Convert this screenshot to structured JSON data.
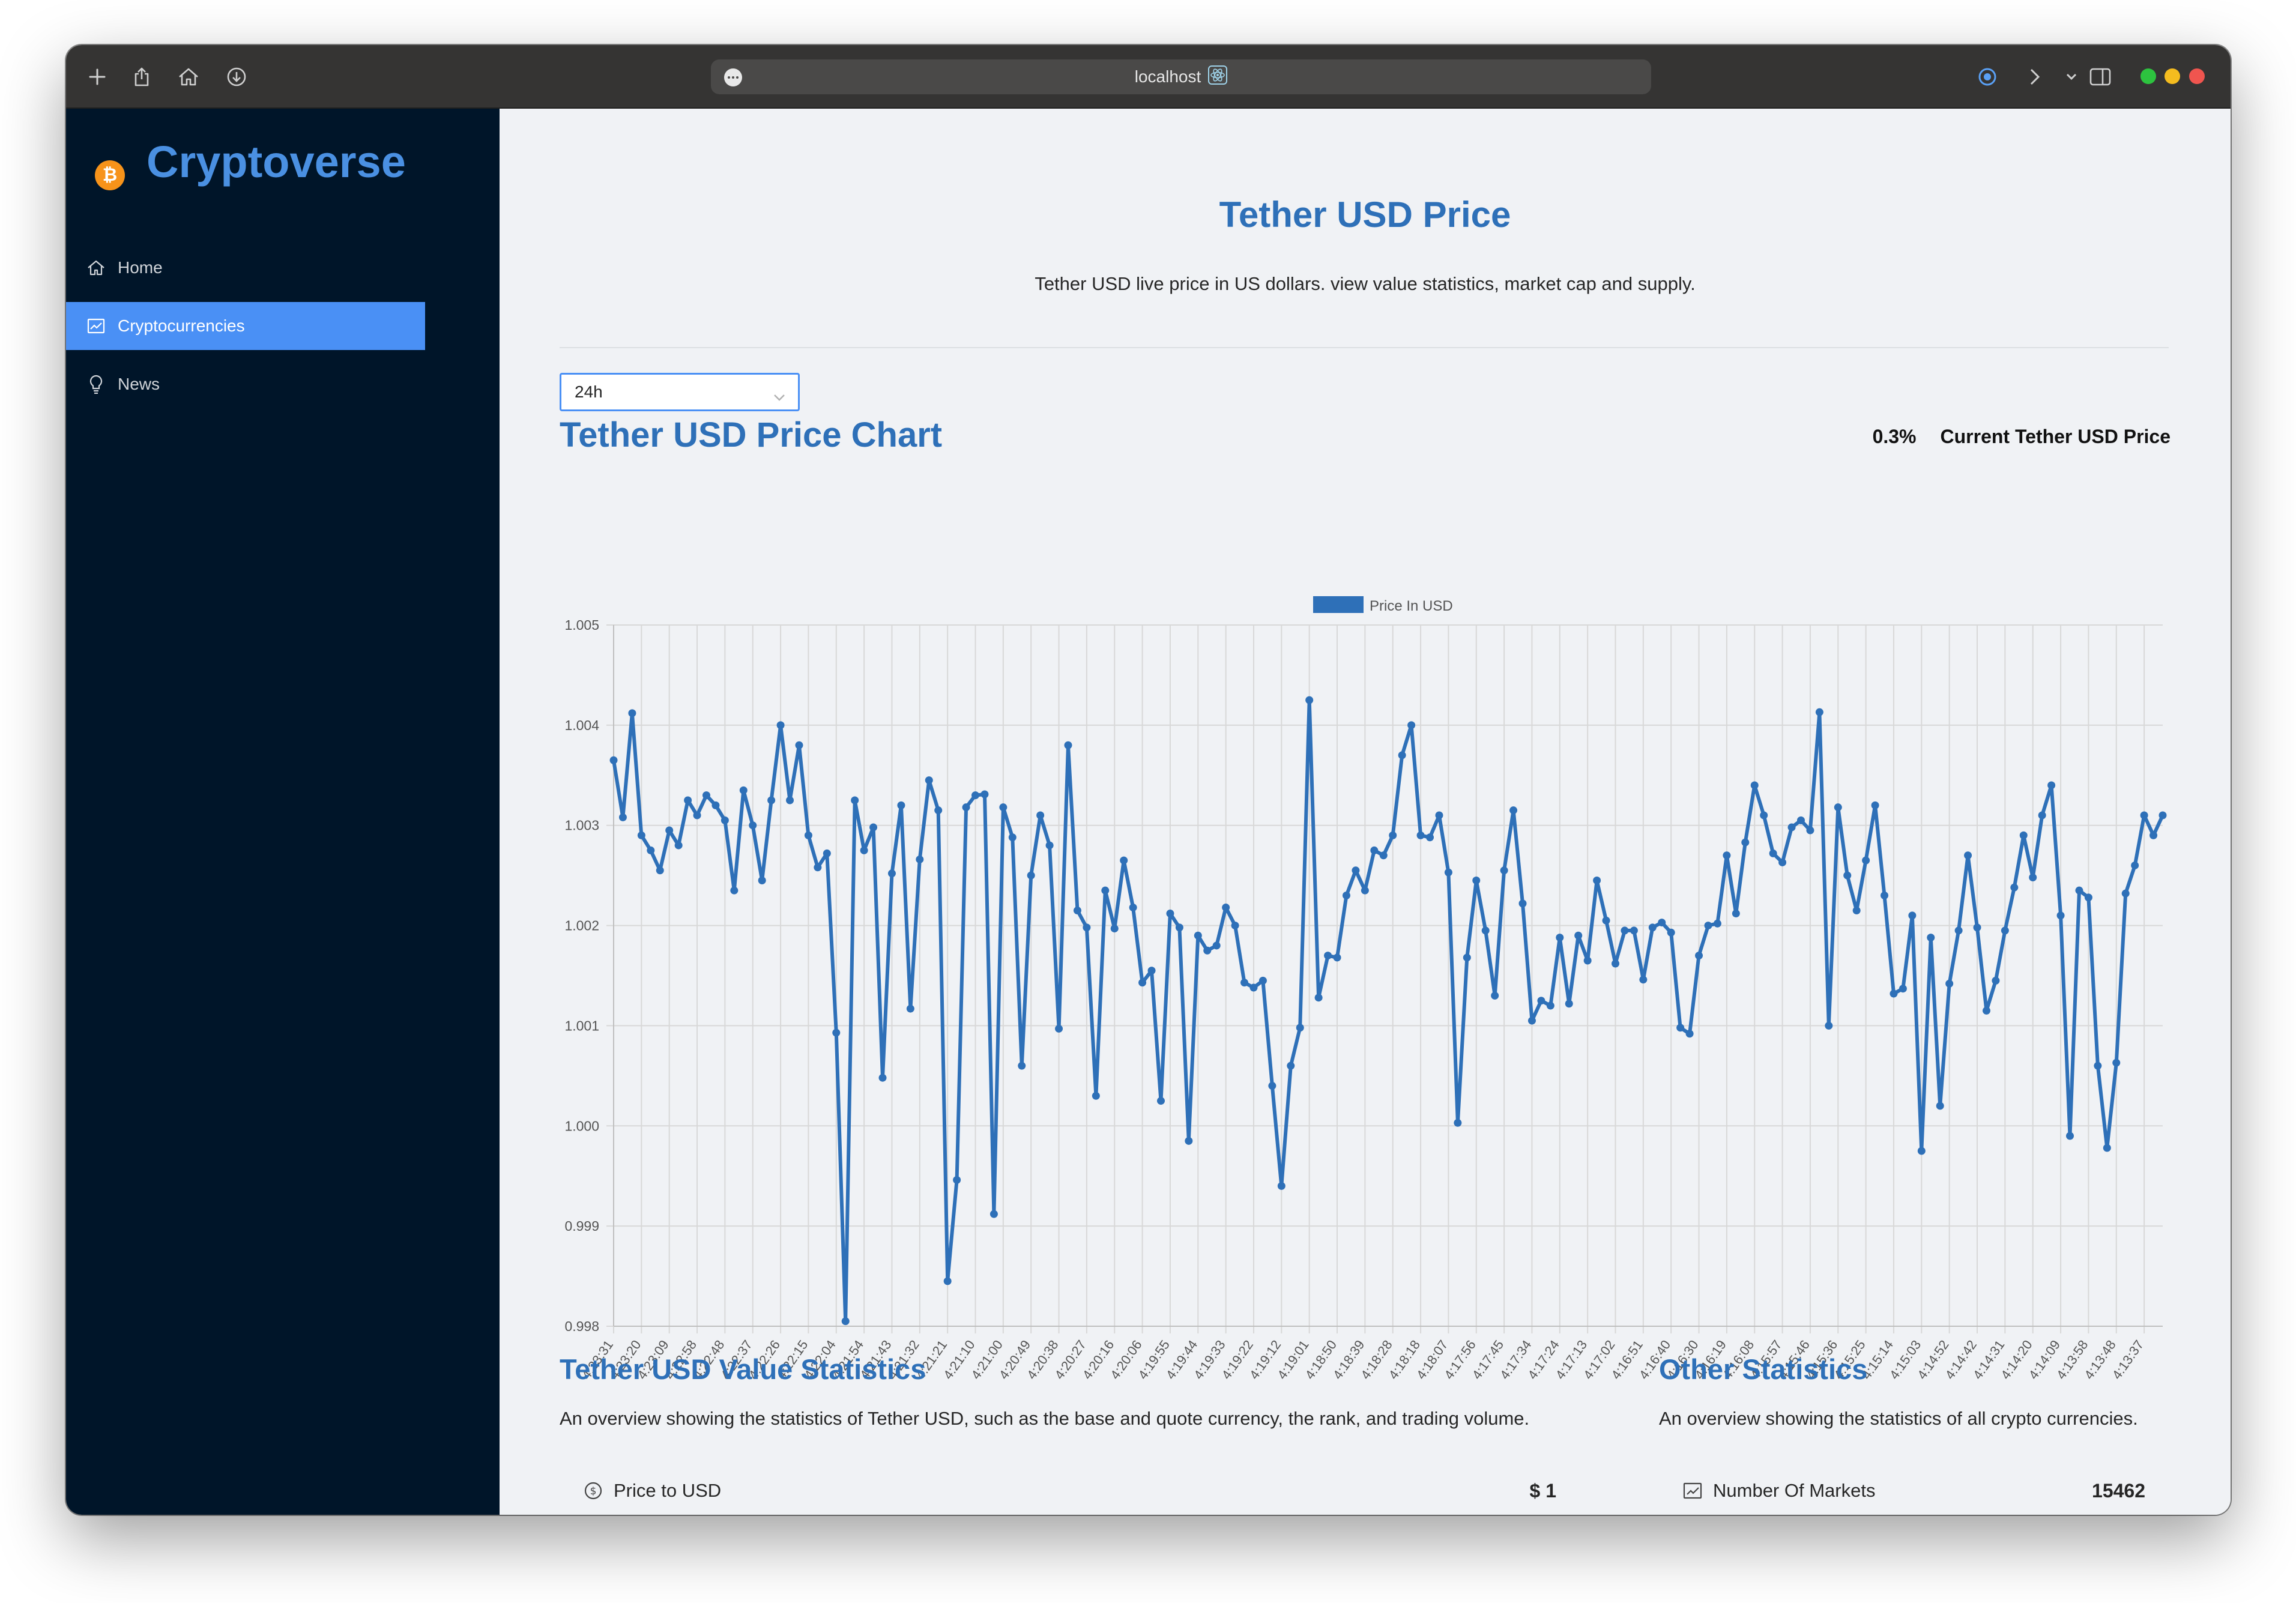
{
  "browser": {
    "url": "localhost",
    "traffic_colors": [
      "#2dc33f",
      "#f5bc1f",
      "#f0554f"
    ]
  },
  "sidebar": {
    "logo_badge": "₿",
    "logo_text": "Cryptoverse",
    "items": [
      {
        "label": "Home",
        "icon": "home-icon"
      },
      {
        "label": "Cryptocurrencies",
        "icon": "fund-icon",
        "active": true
      },
      {
        "label": "News",
        "icon": "bulb-icon"
      }
    ]
  },
  "main": {
    "title": "Tether USD Price",
    "subtitle": "Tether USD live price in US dollars. view value statistics, market cap and supply.",
    "timeperiod": "24h",
    "chart_title": "Tether USD Price Chart",
    "change": "0.3%",
    "current_price_label": "Current Tether USD Price",
    "value_stats": {
      "title": "Tether USD Value Statistics",
      "subtitle": "An overview showing the statistics of Tether USD, such as the base and quote currency, the rank, and trading volume.",
      "rows": [
        {
          "label": "Price to USD",
          "value": "$ 1",
          "icon": "dollar-circle-icon"
        }
      ]
    },
    "other_stats": {
      "title": "Other Statistics",
      "subtitle": "An overview showing the statistics of all crypto currencies.",
      "rows": [
        {
          "label": "Number Of Markets",
          "value": "15462",
          "icon": "fund-icon"
        }
      ]
    }
  },
  "chart_data": {
    "type": "line",
    "legend": "Price In USD",
    "legend_position": "top",
    "color": "#2e70b8",
    "grid": true,
    "ylim": [
      0.998,
      1.005
    ],
    "yticks": [
      "1.005",
      "1.004",
      "1.003",
      "1.002",
      "1.001",
      "1.000",
      "0.999",
      "0.998"
    ],
    "xtick_labels": [
      "4:23:31",
      "4:23:20",
      "4:23:09",
      "4:22:58",
      "4:22:48",
      "4:22:37",
      "4:22:26",
      "4:22:15",
      "4:22:04",
      "4:21:54",
      "4:21:43",
      "4:21:32",
      "4:21:21",
      "4:21:10",
      "4:21:00",
      "4:20:49",
      "4:20:38",
      "4:20:27",
      "4:20:16",
      "4:20:06",
      "4:19:55",
      "4:19:44",
      "4:19:33",
      "4:19:22",
      "4:19:12",
      "4:19:01",
      "4:18:50",
      "4:18:39",
      "4:18:28",
      "4:18:18",
      "4:18:07",
      "4:17:56",
      "4:17:45",
      "4:17:34",
      "4:17:24",
      "4:17:13",
      "4:17:02",
      "4:16:51",
      "4:16:40",
      "4:16:30",
      "4:16:19",
      "4:16:08",
      "4:15:57",
      "4:15:46",
      "4:15:36",
      "4:15:25",
      "4:15:14",
      "4:15:03",
      "4:14:52",
      "4:14:42",
      "4:14:31",
      "4:14:20",
      "4:14:09",
      "4:13:58",
      "4:13:48",
      "4:13:37"
    ],
    "values": [
      1.00365,
      1.00308,
      1.00412,
      1.0029,
      1.00275,
      1.00255,
      1.00295,
      1.0028,
      1.00325,
      1.0031,
      1.0033,
      1.0032,
      1.00305,
      1.00235,
      1.00335,
      1.003,
      1.00245,
      1.00325,
      1.004,
      1.00325,
      1.0038,
      1.0029,
      1.00258,
      1.00272,
      1.00093,
      0.99805,
      1.00325,
      1.00275,
      1.00298,
      1.00048,
      1.00252,
      1.0032,
      1.00117,
      1.00266,
      1.00345,
      1.00315,
      0.99845,
      0.99946,
      1.00318,
      1.0033,
      1.00331,
      0.99912,
      1.00318,
      1.00288,
      1.0006,
      1.0025,
      1.0031,
      1.0028,
      1.00097,
      1.0038,
      1.00215,
      1.00198,
      1.0003,
      1.00235,
      1.00197,
      1.00265,
      1.00218,
      1.00143,
      1.00155,
      1.00025,
      1.00212,
      1.00198,
      0.99985,
      1.0019,
      1.00175,
      1.0018,
      1.00218,
      1.002,
      1.00143,
      1.00138,
      1.00145,
      1.0004,
      0.9994,
      1.0006,
      1.00098,
      1.00425,
      1.00128,
      1.0017,
      1.00168,
      1.0023,
      1.00255,
      1.00235,
      1.00275,
      1.0027,
      1.0029,
      1.0037,
      1.004,
      1.0029,
      1.00288,
      1.0031,
      1.00253,
      1.00003,
      1.00168,
      1.00245,
      1.00195,
      1.0013,
      1.00255,
      1.00315,
      1.00222,
      1.00105,
      1.00125,
      1.0012,
      1.00188,
      1.00122,
      1.0019,
      1.00165,
      1.00245,
      1.00205,
      1.00162,
      1.00195,
      1.00195,
      1.00146,
      1.00198,
      1.00203,
      1.00193,
      1.00098,
      1.00092,
      1.0017,
      1.002,
      1.00202,
      1.0027,
      1.00212,
      1.00283,
      1.0034,
      1.0031,
      1.00272,
      1.00263,
      1.00298,
      1.00305,
      1.00295,
      1.00413,
      1.001,
      1.00318,
      1.0025,
      1.00215,
      1.00265,
      1.0032,
      1.0023,
      1.00132,
      1.00137,
      1.0021,
      0.99975,
      1.00188,
      1.0002,
      1.00142,
      1.00195,
      1.0027,
      1.00198,
      1.00115,
      1.00145,
      1.00195,
      1.00238,
      1.0029,
      1.00248,
      1.0031,
      1.0034,
      1.0021,
      0.9999,
      1.00235,
      1.00228,
      1.0006,
      0.99978,
      1.00063,
      1.00232,
      1.0026,
      1.0031,
      1.0029,
      1.0031
    ]
  }
}
